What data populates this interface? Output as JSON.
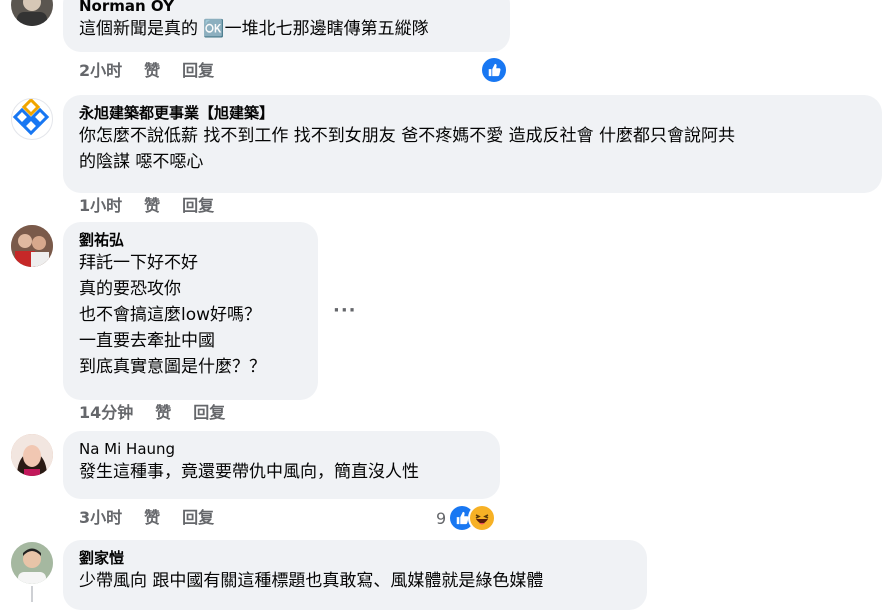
{
  "colors": {
    "accent": "#1877f2",
    "bubble": "#f0f2f5",
    "meta": "#65676b",
    "haha": "#f7b125"
  },
  "comments": [
    {
      "author": "Norman OY",
      "text": "這個新聞是真的 🆗一堆北七那邊瞎傳第五縱隊",
      "time": "2小时",
      "like": "赞",
      "reply": "回复",
      "reactions": {
        "icons": [
          "like-icon"
        ],
        "count": ""
      }
    },
    {
      "author": "永旭建築都更事業【旭建築】",
      "text": "你怎麼不說低薪 找不到工作 找不到女朋友 爸不疼媽不愛 造成反社會 什麼都只會說阿共\n的陰謀 噁不噁心",
      "time": "1小时",
      "like": "赞",
      "reply": "回复"
    },
    {
      "author": "劉祐弘",
      "text": "拜託一下好不好\n真的要恐攻你\n也不會搞這麼low好嗎？\n一直要去牽扯中國\n到底真實意圖是什麼？？",
      "time": "14分钟",
      "like": "赞",
      "reply": "回复",
      "more": "···"
    },
    {
      "author": "Na Mi Haung",
      "text": "發生這種事，竟還要帶仇中風向，簡直沒人性",
      "time": "3小时",
      "like": "赞",
      "reply": "回复",
      "reactions": {
        "icons": [
          "like-icon",
          "haha-icon"
        ],
        "count": "9"
      }
    },
    {
      "author": "劉家愷",
      "text": "少帶風向 跟中國有關這種標題也真敢寫、風媒體就是綠色媒體"
    }
  ]
}
